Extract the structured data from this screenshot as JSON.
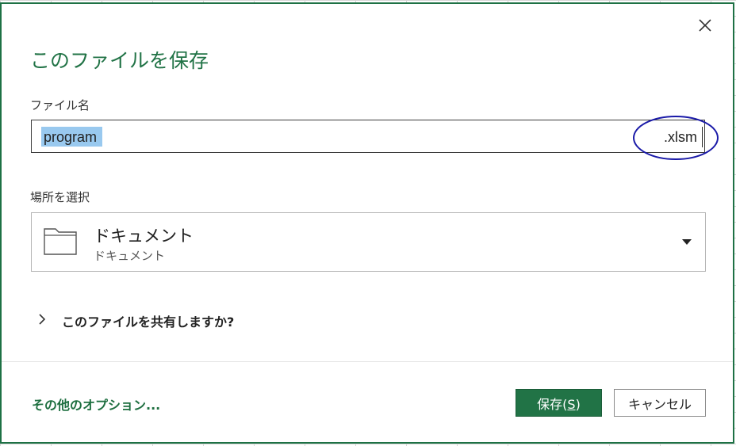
{
  "dialog": {
    "title": "このファイルを保存",
    "close_icon": "close-icon"
  },
  "filename": {
    "label": "ファイル名",
    "value": "program",
    "extension": ".xlsm"
  },
  "location": {
    "label": "場所を選択",
    "primary": "ドキュメント",
    "secondary": "ドキュメント",
    "icon": "folder-icon"
  },
  "share": {
    "label": "このファイルを共有しますか?",
    "expanded": false
  },
  "footer": {
    "more_options": "その他のオプション...",
    "save_label": "保存(S)",
    "save_accelerator": "S",
    "cancel_label": "キャンセル"
  },
  "colors": {
    "accent": "#217346",
    "annotation": "#1a1aa8",
    "selection": "#99c9ef"
  }
}
